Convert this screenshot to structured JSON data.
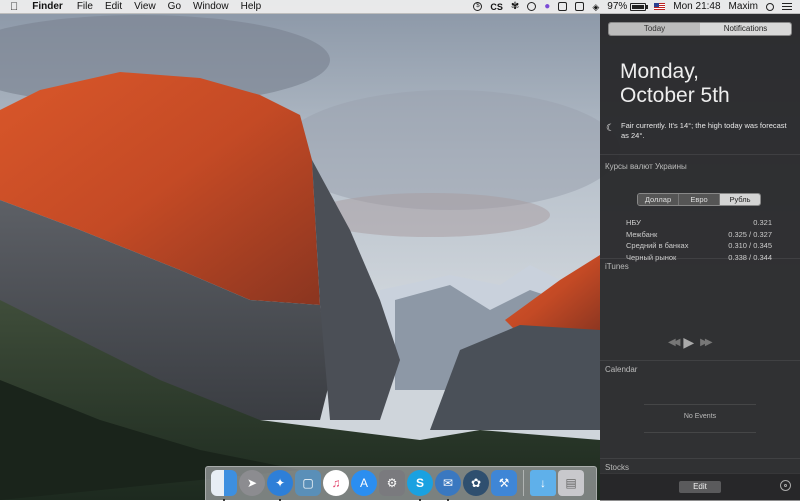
{
  "menubar": {
    "apple_icon": "apple-icon",
    "app_name": "Finder",
    "menus": [
      "File",
      "Edit",
      "View",
      "Go",
      "Window",
      "Help"
    ],
    "status": {
      "cs_label": "CS",
      "battery_percent": 97,
      "battery_label": "97%",
      "clock": "Mon 21:48",
      "user": "Maxim"
    }
  },
  "notification_center": {
    "tabs": [
      "Today",
      "Notifications"
    ],
    "selected_tab": "Notifications",
    "day": "Monday,",
    "date": "October 5th",
    "weather_text": "Fair currently. It's 14°; the high today was forecast as 24°.",
    "currency": {
      "title": "Курсы валют Украины",
      "tabs": [
        "Доллар",
        "Евро",
        "Рубль"
      ],
      "selected_tab": "Рубль",
      "rows": [
        {
          "label": "НБУ",
          "value": "0.321"
        },
        {
          "label": "Межбанк",
          "value": "0.325 / 0.327"
        },
        {
          "label": "Средний в банках",
          "value": "0.310 / 0.345"
        },
        {
          "label": "Черный рынок",
          "value": "0.338 / 0.344"
        }
      ]
    },
    "itunes": {
      "title": "iTunes",
      "prev": "◀◀",
      "play": "▶",
      "next": "▶▶"
    },
    "calendar": {
      "title": "Calendar",
      "empty": "No Events"
    },
    "stocks": {
      "title": "Stocks"
    },
    "edit_label": "Edit"
  },
  "dock": {
    "apps": [
      {
        "name": "finder",
        "color": "#3d8fe0"
      },
      {
        "name": "launchpad",
        "color": "#8c8c90"
      },
      {
        "name": "safari",
        "color": "#2e7fd8"
      },
      {
        "name": "preview",
        "color": "#5a8fb8"
      },
      {
        "name": "itunes",
        "color": "#e3486f"
      },
      {
        "name": "app-store",
        "color": "#2b8ef0"
      },
      {
        "name": "system-preferences",
        "color": "#7a7a7e"
      },
      {
        "name": "skype",
        "color": "#1aa1e1"
      },
      {
        "name": "messages",
        "color": "#3a78c0"
      },
      {
        "name": "sourcetree",
        "color": "#2f4f6f"
      },
      {
        "name": "xcode",
        "color": "#3f86d6"
      },
      {
        "name": "downloads-folder",
        "color": "#5fb0ea"
      },
      {
        "name": "trash",
        "color": "#c8c8cc"
      }
    ]
  }
}
